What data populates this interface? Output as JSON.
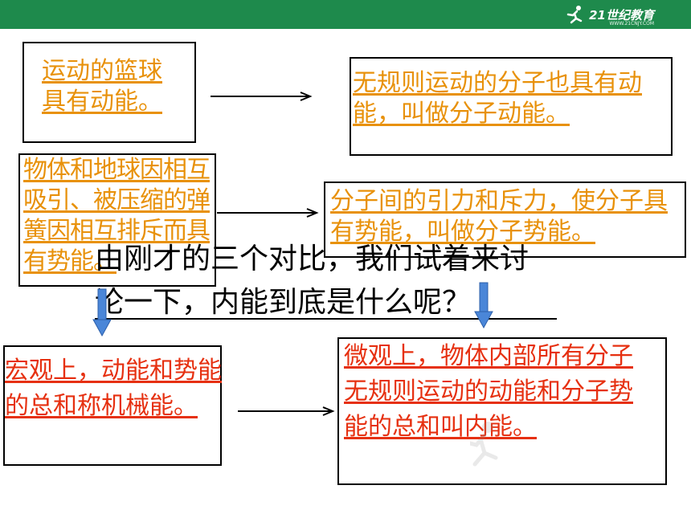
{
  "header": {
    "logo_text": "21世纪教育",
    "logo_sub": "WWW.21CNJY.COM",
    "bar_color": "#1e8a4c"
  },
  "boxes": {
    "ball": "运动的篮球具有动能。",
    "molecule_kinetic": "无规则运动的分子也具有动能，叫做分子动能。",
    "earth_spring": "物体和地球因相互吸引、被压缩的弹簧因相互排斥而具有势能。",
    "molecule_potential": "分子间的引力和斥力，使分子具有势能，叫做分子势能。",
    "macro": "宏观上，动能和势能的总和称机械能。",
    "micro": "微观上，物体内部所有分子无规则运动的动能和分子势能的总和叫内能。"
  },
  "question": {
    "line1": "由刚才的三个对比，我们试着来讨",
    "line2": "论一下，内能到底是什么呢？"
  },
  "watermark": {
    "text": "21世纪教育",
    "sub": "WWW.21CNJY.COM"
  },
  "colors": {
    "orange_text": "#e8910a",
    "red_text": "#e63010",
    "down_arrow": "#4a86d8"
  }
}
